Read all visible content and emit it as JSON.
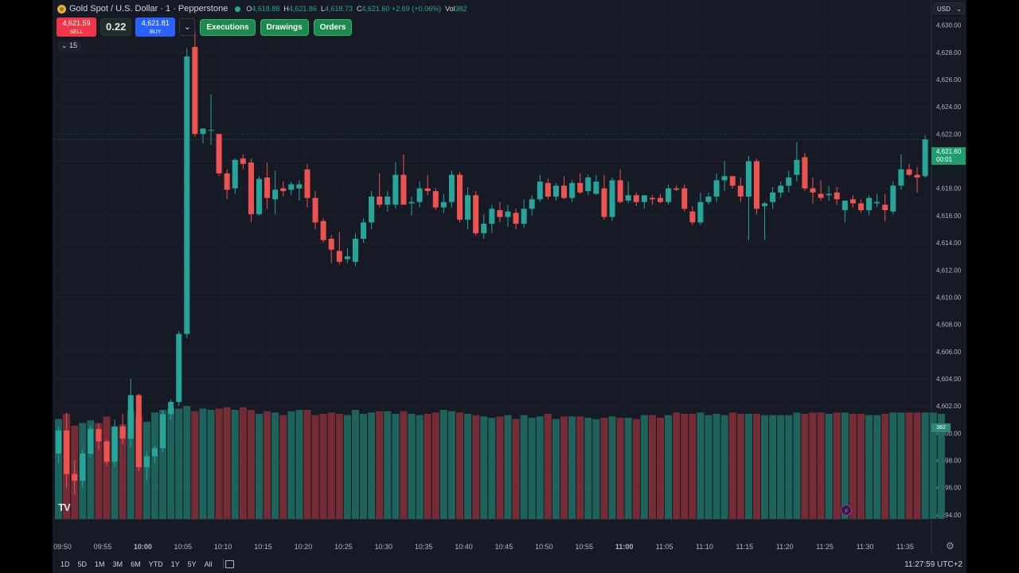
{
  "header": {
    "symbol_title": "Gold Spot / U.S. Dollar · 1 · Pepperstone",
    "ohlc": [
      {
        "label": "O",
        "value": "4,618.88"
      },
      {
        "label": "H",
        "value": "4,621.86"
      },
      {
        "label": "L",
        "value": "4,618.73"
      },
      {
        "label": "C",
        "value": "4,621.60 +2.69 (+0.06%)"
      }
    ],
    "volume_label": "Vol",
    "volume_value": "382"
  },
  "trade": {
    "sell_price": "4,621.59",
    "sell_label": "SELL",
    "spread": "0.22",
    "buy_price": "4,621.81",
    "buy_label": "BUY",
    "dropdown_glyph": "⌄"
  },
  "toolbar": {
    "buttons": [
      "Executions",
      "Drawings",
      "Orders"
    ]
  },
  "interval_label": "⌄ 15",
  "currency": "USD",
  "currency_chevron": "⌄",
  "last_price_tag": {
    "price": "4,621.60",
    "countdown": "00:01"
  },
  "volume_tag": "382",
  "logo_text": "TV",
  "bolt_glyph": "⚡",
  "settings_glyph": "⚙",
  "bottom_bar": {
    "timeframes": [
      "1D",
      "5D",
      "1M",
      "3M",
      "6M",
      "YTD",
      "1Y",
      "5Y",
      "All"
    ],
    "clock": "11:27:59 UTC+2"
  },
  "colors": {
    "up": "#26a69a",
    "down": "#ef5350",
    "background": "#161a25"
  },
  "chart_data": {
    "type": "candlestick",
    "y_ticks": [
      "4,630.00",
      "4,628.00",
      "4,626.00",
      "4,624.00",
      "4,622.00",
      "4,620.00",
      "4,618.00",
      "4,616.00",
      "4,614.00",
      "4,612.00",
      "4,610.00",
      "4,608.00",
      "4,606.00",
      "4,604.00",
      "4,602.00",
      "4,600.00",
      "4,598.00",
      "4,596.00",
      "4,594.00"
    ],
    "x_ticks": [
      {
        "label": "09:50",
        "bar": 0.5
      },
      {
        "label": "09:55",
        "bar": 5.5
      },
      {
        "label": "10:00",
        "bar": 10.5,
        "bold": true
      },
      {
        "label": "10:05",
        "bar": 15.5
      },
      {
        "label": "10:10",
        "bar": 20.5
      },
      {
        "label": "10:15",
        "bar": 25.5
      },
      {
        "label": "10:20",
        "bar": 30.5
      },
      {
        "label": "10:25",
        "bar": 35.5
      },
      {
        "label": "10:30",
        "bar": 40.5
      },
      {
        "label": "10:35",
        "bar": 45.5
      },
      {
        "label": "10:40",
        "bar": 50.5
      },
      {
        "label": "10:45",
        "bar": 55.5
      },
      {
        "label": "10:50",
        "bar": 60.5
      },
      {
        "label": "10:55",
        "bar": 65.5
      },
      {
        "label": "11:00",
        "bar": 70.5,
        "bold": true
      },
      {
        "label": "11:05",
        "bar": 75.5
      },
      {
        "label": "11:10",
        "bar": 80.5
      },
      {
        "label": "11:15",
        "bar": 85.5
      },
      {
        "label": "11:20",
        "bar": 90.5
      },
      {
        "label": "11:25",
        "bar": 95.5
      },
      {
        "label": "11:30",
        "bar": 100.5
      },
      {
        "label": "11:35",
        "bar": 105.5
      }
    ],
    "y_range": [
      4593.0,
      4631.5
    ],
    "last_price": 4621.6,
    "candles": [
      [
        4598.5,
        4600.5,
        4597.8,
        4600.2
      ],
      [
        4600.2,
        4601.5,
        4596.0,
        4597.0
      ],
      [
        4597.0,
        4598.0,
        4595.5,
        4596.5
      ],
      [
        4596.5,
        4598.8,
        4596.0,
        4598.5
      ],
      [
        4598.5,
        4600.6,
        4598.2,
        4600.3
      ],
      [
        4600.3,
        4600.7,
        4598.8,
        4599.4
      ],
      [
        4599.4,
        4599.6,
        4597.6,
        4597.9
      ],
      [
        4597.9,
        4601.0,
        4597.5,
        4600.5
      ],
      [
        4600.5,
        4601.4,
        4599.2,
        4599.6
      ],
      [
        4599.6,
        4604.0,
        4599.0,
        4602.8
      ],
      [
        4602.8,
        4602.9,
        4597.2,
        4597.5
      ],
      [
        4597.5,
        4598.6,
        4596.5,
        4598.3
      ],
      [
        4598.3,
        4599.1,
        4597.8,
        4598.9
      ],
      [
        4598.9,
        4601.7,
        4598.6,
        4601.4
      ],
      [
        4601.4,
        4602.5,
        4601.0,
        4602.3
      ],
      [
        4602.3,
        4607.5,
        4602.0,
        4607.3
      ],
      [
        4607.3,
        4628.3,
        4607.0,
        4627.7
      ],
      [
        4628.4,
        4629.6,
        4621.8,
        4622.0
      ],
      [
        4622.0,
        4622.4,
        4621.3,
        4622.4
      ],
      [
        4622.3,
        4624.9,
        4621.2,
        4622.3
      ],
      [
        4622.0,
        4622.0,
        4618.9,
        4619.1
      ],
      [
        4619.1,
        4619.4,
        4617.2,
        4617.9
      ],
      [
        4618.0,
        4620.2,
        4617.6,
        4620.1
      ],
      [
        4620.2,
        4620.5,
        4619.4,
        4619.8
      ],
      [
        4619.9,
        4620.2,
        4615.5,
        4616.1
      ],
      [
        4616.1,
        4618.9,
        4616.0,
        4618.7
      ],
      [
        4618.8,
        4619.9,
        4616.5,
        4617.3
      ],
      [
        4617.2,
        4619.3,
        4616.1,
        4617.9
      ],
      [
        4618.0,
        4618.5,
        4617.4,
        4617.8
      ],
      [
        4617.9,
        4618.5,
        4617.5,
        4618.3
      ],
      [
        4618.0,
        4618.6,
        4617.1,
        4618.3
      ],
      [
        4619.4,
        4619.8,
        4616.6,
        4617.3
      ],
      [
        4617.3,
        4617.8,
        4615.0,
        4615.5
      ],
      [
        4615.6,
        4615.8,
        4614.0,
        4614.2
      ],
      [
        4614.3,
        4614.6,
        4612.5,
        4613.5
      ],
      [
        4613.4,
        4614.8,
        4612.4,
        4612.6
      ],
      [
        4612.8,
        4613.6,
        4612.5,
        4613.0
      ],
      [
        4612.6,
        4614.7,
        4612.3,
        4614.3
      ],
      [
        4614.3,
        4615.8,
        4614.0,
        4615.5
      ],
      [
        4615.5,
        4617.8,
        4615.0,
        4617.4
      ],
      [
        4617.4,
        4619.1,
        4616.6,
        4616.8
      ],
      [
        4616.8,
        4617.8,
        4616.3,
        4617.4
      ],
      [
        4616.8,
        4619.9,
        4616.5,
        4619.0
      ],
      [
        4619.0,
        4620.5,
        4616.8,
        4616.8
      ],
      [
        4616.9,
        4617.4,
        4616.0,
        4617.0
      ],
      [
        4617.0,
        4618.5,
        4616.6,
        4618.0
      ],
      [
        4618.0,
        4619.0,
        4617.5,
        4617.8
      ],
      [
        4617.8,
        4618.0,
        4616.4,
        4616.6
      ],
      [
        4616.6,
        4617.6,
        4616.2,
        4617.0
      ],
      [
        4617.0,
        4619.3,
        4616.6,
        4619.0
      ],
      [
        4619.0,
        4619.2,
        4615.5,
        4615.7
      ],
      [
        4615.7,
        4618.1,
        4615.0,
        4617.5
      ],
      [
        4617.5,
        4617.8,
        4614.5,
        4614.7
      ],
      [
        4614.7,
        4616.1,
        4614.3,
        4615.4
      ],
      [
        4615.4,
        4616.8,
        4614.7,
        4616.5
      ],
      [
        4616.4,
        4617.0,
        4615.5,
        4615.9
      ],
      [
        4615.9,
        4616.8,
        4615.2,
        4616.3
      ],
      [
        4616.2,
        4616.5,
        4615.0,
        4615.4
      ],
      [
        4615.4,
        4617.2,
        4615.1,
        4616.5
      ],
      [
        4616.5,
        4617.5,
        4616.0,
        4617.2
      ],
      [
        4617.2,
        4619.0,
        4617.0,
        4618.5
      ],
      [
        4618.4,
        4618.7,
        4617.2,
        4617.4
      ],
      [
        4617.4,
        4618.4,
        4617.1,
        4618.2
      ],
      [
        4618.2,
        4618.9,
        4617.2,
        4617.3
      ],
      [
        4617.3,
        4618.6,
        4617.0,
        4618.4
      ],
      [
        4618.4,
        4619.1,
        4617.6,
        4617.7
      ],
      [
        4617.8,
        4619.0,
        4617.5,
        4618.8
      ],
      [
        4617.6,
        4619.0,
        4617.5,
        4618.5
      ],
      [
        4618.0,
        4619.0,
        4615.7,
        4615.9
      ],
      [
        4615.9,
        4618.8,
        4615.6,
        4618.6
      ],
      [
        4618.6,
        4619.4,
        4616.9,
        4617.0
      ],
      [
        4617.1,
        4618.5,
        4616.9,
        4617.5
      ],
      [
        4617.5,
        4617.7,
        4616.7,
        4617.0
      ],
      [
        4617.0,
        4617.5,
        4616.5,
        4617.5
      ],
      [
        4617.3,
        4617.5,
        4616.8,
        4617.2
      ],
      [
        4617.3,
        4617.6,
        4616.9,
        4617.0
      ],
      [
        4617.0,
        4618.3,
        4616.8,
        4618.0
      ],
      [
        4618.0,
        4618.2,
        4617.8,
        4617.9
      ],
      [
        4618.0,
        4618.3,
        4616.3,
        4616.5
      ],
      [
        4616.3,
        4616.7,
        4615.3,
        4615.5
      ],
      [
        4615.5,
        4617.7,
        4615.3,
        4617.0
      ],
      [
        4617.0,
        4617.7,
        4616.8,
        4617.4
      ],
      [
        4617.4,
        4619.1,
        4617.0,
        4618.6
      ],
      [
        4618.6,
        4620.0,
        4617.8,
        4618.9
      ],
      [
        4618.9,
        4618.9,
        4618.0,
        4618.2
      ],
      [
        4618.2,
        4618.8,
        4617.0,
        4617.4
      ],
      [
        4617.4,
        4620.4,
        4614.2,
        4620.0
      ],
      [
        4620.0,
        4620.2,
        4616.1,
        4616.5
      ],
      [
        4616.7,
        4617.0,
        4614.2,
        4616.9
      ],
      [
        4617.0,
        4618.1,
        4616.5,
        4617.7
      ],
      [
        4617.7,
        4618.5,
        4617.3,
        4618.2
      ],
      [
        4618.2,
        4619.3,
        4617.7,
        4618.8
      ],
      [
        4619.0,
        4621.4,
        4618.5,
        4620.1
      ],
      [
        4620.3,
        4620.6,
        4617.8,
        4618.0
      ],
      [
        4618.0,
        4618.8,
        4616.9,
        4617.7
      ],
      [
        4617.6,
        4618.6,
        4617.1,
        4617.3
      ],
      [
        4617.5,
        4618.2,
        4617.1,
        4617.6
      ],
      [
        4617.7,
        4618.1,
        4616.8,
        4617.2
      ],
      [
        4616.4,
        4617.1,
        4615.5,
        4617.1
      ],
      [
        4617.2,
        4617.5,
        4616.6,
        4616.9
      ],
      [
        4616.9,
        4617.2,
        4616.2,
        4616.4
      ],
      [
        4616.4,
        4617.5,
        4616.0,
        4617.3
      ],
      [
        4616.9,
        4617.6,
        4616.6,
        4617.0
      ],
      [
        4616.8,
        4617.6,
        4615.6,
        4616.4
      ],
      [
        4616.3,
        4618.5,
        4616.1,
        4618.2
      ],
      [
        4618.2,
        4620.5,
        4617.9,
        4619.4
      ],
      [
        4619.4,
        4619.8,
        4618.9,
        4619.0
      ],
      [
        4619.0,
        4619.6,
        4617.7,
        4618.8
      ],
      [
        4618.9,
        4621.9,
        4618.8,
        4621.6
      ]
    ],
    "volume": {
      "max_value": 100,
      "values": [
        76,
        80,
        71,
        73,
        75,
        73,
        78,
        70,
        72,
        82,
        78,
        74,
        81,
        83,
        84,
        84,
        86,
        82,
        84,
        83,
        84,
        85,
        83,
        85,
        83,
        80,
        82,
        81,
        79,
        82,
        83,
        83,
        79,
        80,
        81,
        80,
        79,
        83,
        80,
        81,
        82,
        82,
        80,
        82,
        80,
        79,
        80,
        81,
        83,
        82,
        81,
        80,
        79,
        78,
        77,
        78,
        79,
        76,
        79,
        77,
        78,
        80,
        76,
        78,
        78,
        78,
        77,
        76,
        77,
        78,
        77,
        77,
        76,
        79,
        79,
        77,
        79,
        81,
        80,
        80,
        81,
        79,
        80,
        79,
        81,
        80,
        80,
        80,
        79,
        79,
        79,
        79,
        81,
        80,
        81,
        81,
        80,
        81,
        81,
        80,
        80,
        79,
        79,
        80,
        81,
        81,
        81,
        81,
        81,
        81,
        80
      ]
    }
  }
}
